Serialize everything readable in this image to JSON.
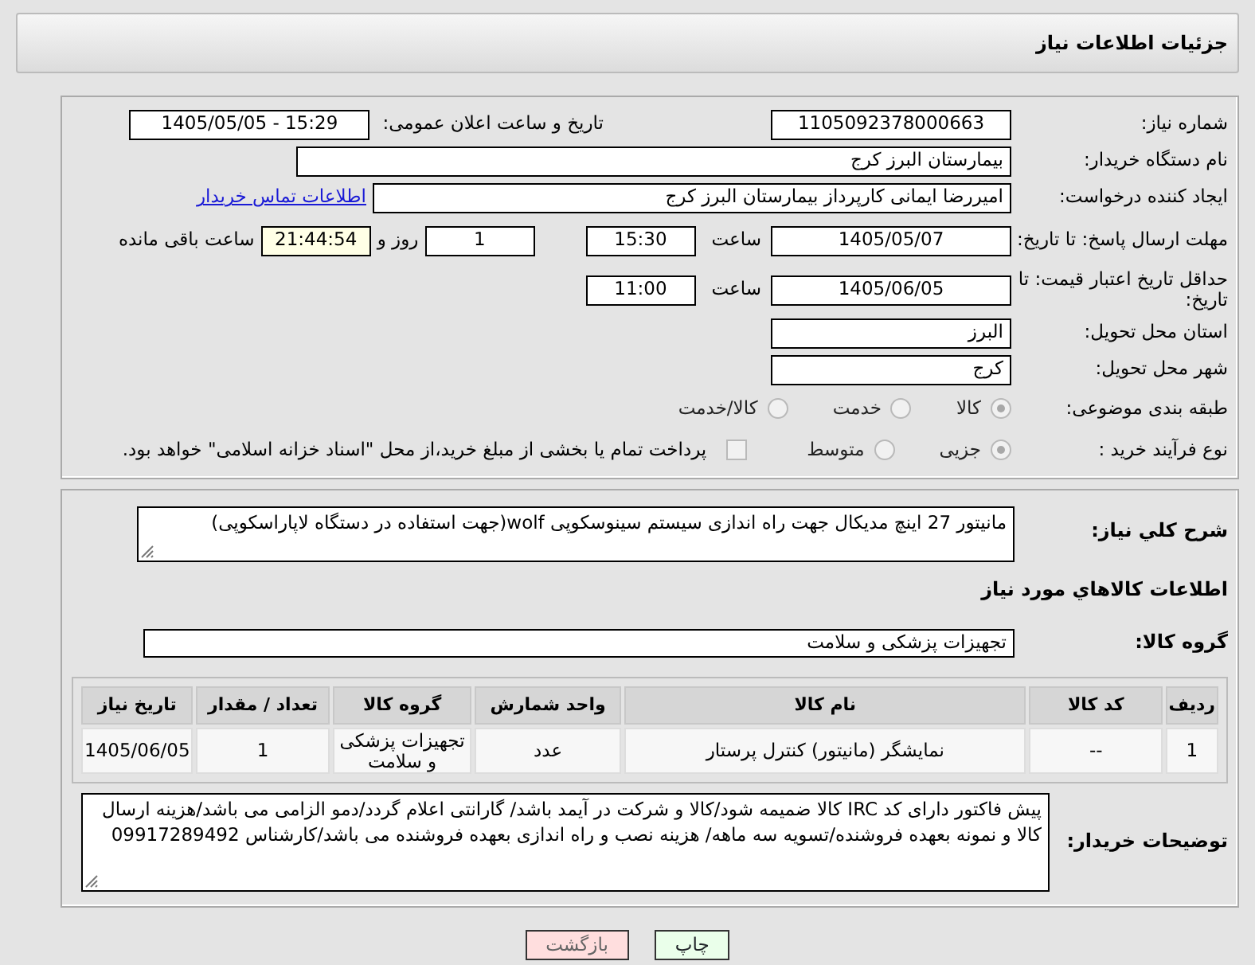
{
  "header": {
    "title": "جزئیات اطلاعات نیاز"
  },
  "need_number": {
    "label": "شماره نیاز:",
    "value": "1105092378000663"
  },
  "announce": {
    "label": "تاریخ و ساعت اعلان عمومی:",
    "value": "1405/05/05 - 15:29"
  },
  "buyer_org": {
    "label": "نام دستگاه خریدار:",
    "value": "بیمارستان البرز کرج"
  },
  "creator": {
    "label": "ایجاد کننده درخواست:",
    "value": "امیررضا ایمانی کارپرداز بیمارستان البرز کرج",
    "link": "اطلاعات تماس خریدار"
  },
  "response_deadline": {
    "label": "مهلت ارسال پاسخ: تا تاریخ:",
    "date": "1405/05/07",
    "time_label": "ساعت",
    "time": "15:30",
    "days": "1",
    "days_label": "روز و",
    "remaining": "21:44:54",
    "remaining_label": "ساعت باقی مانده"
  },
  "price_validity": {
    "label": "حداقل تاریخ اعتبار قیمت: تا تاریخ:",
    "date": "1405/06/05",
    "time_label": "ساعت",
    "time": "11:00"
  },
  "province": {
    "label": "استان محل تحویل:",
    "value": "البرز"
  },
  "city": {
    "label": "شهر محل تحویل:",
    "value": "کرج"
  },
  "category": {
    "label": "طبقه بندی موضوعی:",
    "disabled": true,
    "options": [
      {
        "label": "کالا",
        "selected": true
      },
      {
        "label": "خدمت",
        "selected": false
      },
      {
        "label": "کالا/خدمت",
        "selected": false
      }
    ]
  },
  "process": {
    "label": "نوع فرآیند خرید :",
    "disabled": true,
    "options": [
      {
        "label": "جزیی",
        "selected": true
      },
      {
        "label": "متوسط",
        "selected": false
      }
    ],
    "payment": {
      "checked": false,
      "text": "پرداخت تمام یا بخشی از مبلغ خرید،از محل \"اسناد خزانه اسلامی\" خواهد بود."
    }
  },
  "description": {
    "label": "شرح کلي نياز:",
    "value": "مانیتور 27 اینچ مدیکال جهت راه اندازی سیستم سینوسکوپی wolf(جهت استفاده در دستگاه لاپاراسکوپی)"
  },
  "goods_title": "اطلاعات کالاهاي مورد نياز",
  "goods_group": {
    "label": "گروه کالا:",
    "value": "تجهیزات پزشکی و سلامت"
  },
  "table": {
    "columns": [
      "ردیف",
      "کد کالا",
      "نام کالا",
      "واحد شمارش",
      "گروه کالا",
      "تعداد / مقدار",
      "تاریخ نیاز"
    ],
    "rows": [
      [
        "1",
        "--",
        "نمایشگر (مانیتور) کنترل پرستار",
        "عدد",
        "تجهیزات پزشکی و سلامت",
        "1",
        "1405/06/05"
      ]
    ]
  },
  "buyer_notes": {
    "label": "توضیحات خریدار:",
    "value": "پیش فاکتور دارای کد IRC کالا ضمیمه شود/کالا و شرکت در آیمد باشد/ گارانتی اعلام گردد/دمو الزامی می باشد/هزینه ارسال کالا و نمونه بعهده فروشنده/تسویه سه ماهه/ هزینه نصب و راه اندازی بعهده فروشنده می باشد/کارشناس 09917289492"
  },
  "buttons": [
    {
      "label": "چاپ",
      "kind": "print"
    },
    {
      "label": "بازگشت",
      "kind": "back"
    }
  ]
}
